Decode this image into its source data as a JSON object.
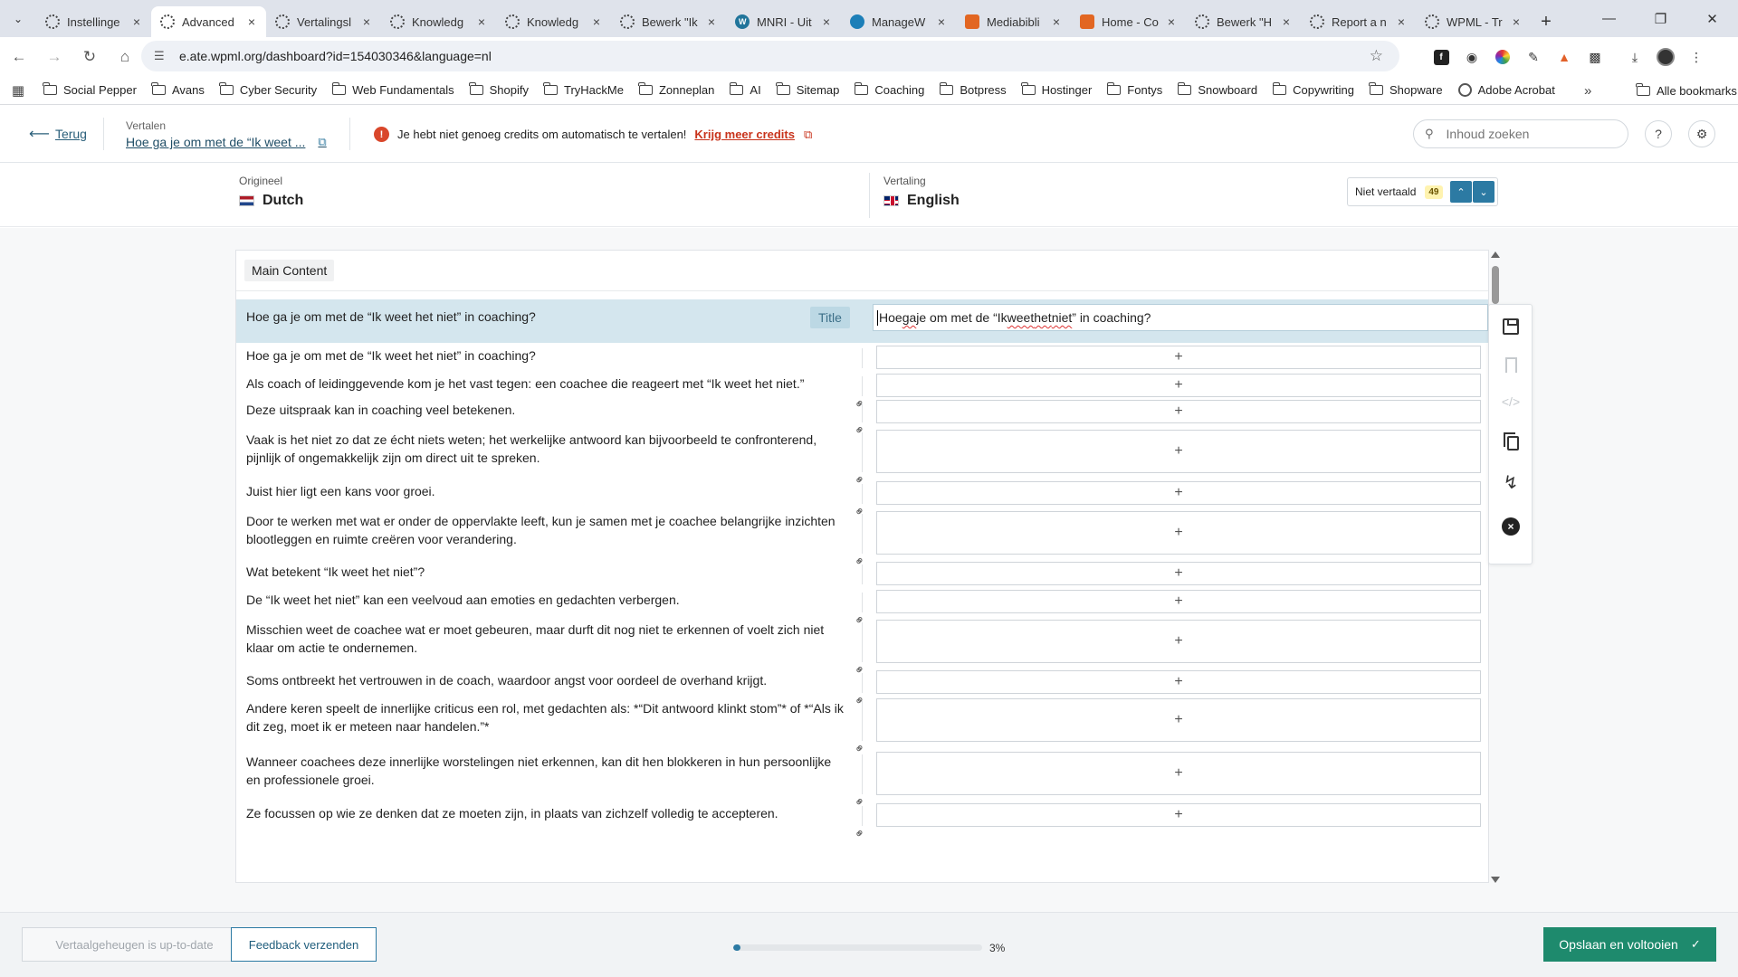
{
  "browser": {
    "tabs": [
      {
        "label": "Instellinge",
        "icon": "gear"
      },
      {
        "label": "Advanced",
        "icon": "gear",
        "active": true
      },
      {
        "label": "Vertalingsl",
        "icon": "gear"
      },
      {
        "label": "Knowledg",
        "icon": "gear"
      },
      {
        "label": "Knowledg",
        "icon": "gear"
      },
      {
        "label": "Bewerk \"Ik",
        "icon": "gear"
      },
      {
        "label": "MNRI - Uit",
        "icon": "wp"
      },
      {
        "label": "ManageW",
        "icon": "bird"
      },
      {
        "label": "Mediabibli",
        "icon": "orange"
      },
      {
        "label": "Home - Co",
        "icon": "orange"
      },
      {
        "label": "Bewerk \"H",
        "icon": "gear"
      },
      {
        "label": "Report a n",
        "icon": "gear"
      },
      {
        "label": "WPML - Tr",
        "icon": "gear"
      }
    ],
    "url": "e.ate.wpml.org/dashboard?id=154030346&language=nl",
    "bookmarks": [
      "Social Pepper",
      "Avans",
      "Cyber Security",
      "Web Fundamentals",
      "Shopify",
      "TryHackMe",
      "Zonneplan",
      "AI",
      "Sitemap",
      "Coaching",
      "Botpress",
      "Hostinger",
      "Fontys",
      "Snowboard",
      "Copywriting",
      "Shopware",
      "Adobe Acrobat"
    ],
    "all_bookmarks": "Alle bookmarks"
  },
  "header": {
    "back_label": "Terug",
    "translate_label": "Vertalen",
    "doc_title": "Hoe ga je om met de “Ik weet ...",
    "credits_warning": "Je hebt niet genoeg credits om automatisch te vertalen!",
    "credits_link": "Krijg meer credits",
    "search_placeholder": "Inhoud zoeken"
  },
  "languages": {
    "source_label": "Origineel",
    "source_name": "Dutch",
    "target_label": "Vertaling",
    "target_name": "English",
    "filter_label": "Niet vertaald",
    "filter_count": "49"
  },
  "editor": {
    "section": "Main Content",
    "active_tag": "Title",
    "active_source": "Hoe ga je om met de “Ik weet het niet” in coaching?",
    "active_target": {
      "pre": "Hoe ",
      "s1": "ga",
      "mid1": " je om met de “Ik ",
      "s2": "weet",
      "sp": " ",
      "s3": "het",
      "sp2": " ",
      "s4": "niet",
      "post": "” in coaching?"
    },
    "segments": [
      "Hoe ga je om met de “Ik weet het niet” in coaching?",
      "Als coach of leidinggevende kom je het vast tegen: een coachee die reageert met “Ik weet het niet.”",
      "Deze uitspraak kan in coaching veel betekenen.",
      "Vaak is het niet zo dat ze écht niets weten; het werkelijke antwoord kan bijvoorbeeld te confronterend, pijnlijk of ongemakkelijk zijn om direct uit te spreken.",
      "Juist hier ligt een kans voor groei.",
      "Door te werken met wat er onder de oppervlakte leeft, kun je samen met je coachee belangrijke inzichten blootleggen en ruimte creëren voor verandering.",
      "Wat betekent “Ik weet het niet”?",
      "De “Ik weet het niet” kan een veelvoud aan emoties en gedachten verbergen.",
      "Misschien weet de coachee wat er moet gebeuren, maar durft dit nog niet te erkennen of voelt zich niet klaar om actie te ondernemen.",
      "Soms ontbreekt het vertrouwen in de coach, waardoor angst voor oordeel de overhand krijgt.",
      "Andere keren speelt de innerlijke criticus een rol, met gedachten als: *“Dit antwoord klinkt stom”* of *“Als ik dit zeg, moet ik er meteen naar handelen.”*",
      "Wanneer coachees deze innerlijke worstelingen niet erkennen, kan dit hen blokkeren in hun persoonlijke en professionele groei.",
      "Ze focussen op wie ze denken dat ze moeten zijn, in plaats van zichzelf volledig te accepteren."
    ],
    "add_symbol": "+"
  },
  "footer": {
    "tm_button": "Vertaalgeheugen is up-to-date",
    "feedback_button": "Feedback verzenden",
    "progress": 0.03,
    "progress_label": "3%",
    "save_button": "Opslaan en voltooien"
  },
  "colors": {
    "accent": "#2c7aa3",
    "save": "#1e8a6d",
    "warning": "#c8331b",
    "active_row": "#d4e6ee"
  }
}
